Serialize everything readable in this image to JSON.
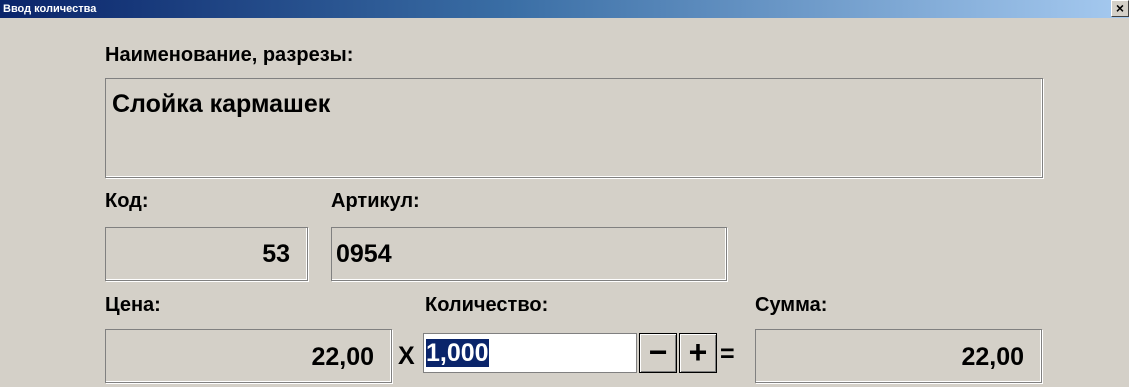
{
  "window": {
    "title": "Ввод количества",
    "close_label": "×"
  },
  "name_section": {
    "label": "Наименование, разрезы:",
    "value": "Слойка кармашек"
  },
  "code": {
    "label": "Код:",
    "value": "53"
  },
  "article": {
    "label": "Артикул:",
    "value": "0954"
  },
  "price": {
    "label": "Цена:",
    "value": "22,00"
  },
  "quantity": {
    "label": "Количество:",
    "value": "1,000",
    "multiply_sign": "X",
    "minus_label": "−",
    "plus_label": "+"
  },
  "sum": {
    "label": "Сумма:",
    "equals_sign": "=",
    "value": "22,00"
  }
}
